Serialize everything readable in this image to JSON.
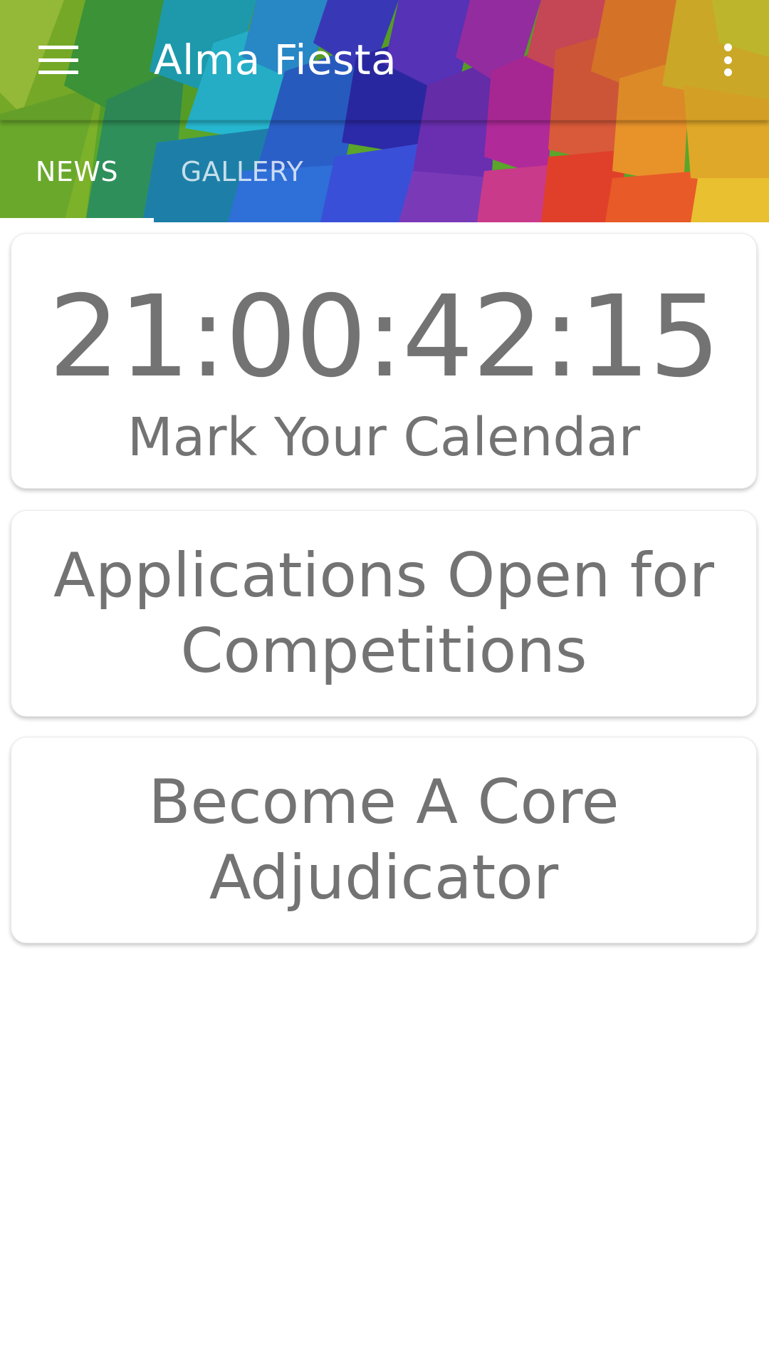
{
  "app_bar": {
    "title": "Alma Fiesta",
    "menu_icon": "hamburger-menu-icon",
    "overflow_icon": "more-vert-icon"
  },
  "tabs": [
    {
      "label": "NEWS",
      "selected": true
    },
    {
      "label": "GALLERY",
      "selected": false
    }
  ],
  "cards": {
    "countdown": {
      "value": "21:00:42:15",
      "caption": "Mark Your Calendar"
    },
    "applications": {
      "text": "Applications Open for Competitions"
    },
    "adjudicator": {
      "text": "Become A Core Adjudicator"
    }
  },
  "colors": {
    "card_text": "#737373",
    "tab_indicator": "#ffffff",
    "header_text": "#ffffff"
  }
}
